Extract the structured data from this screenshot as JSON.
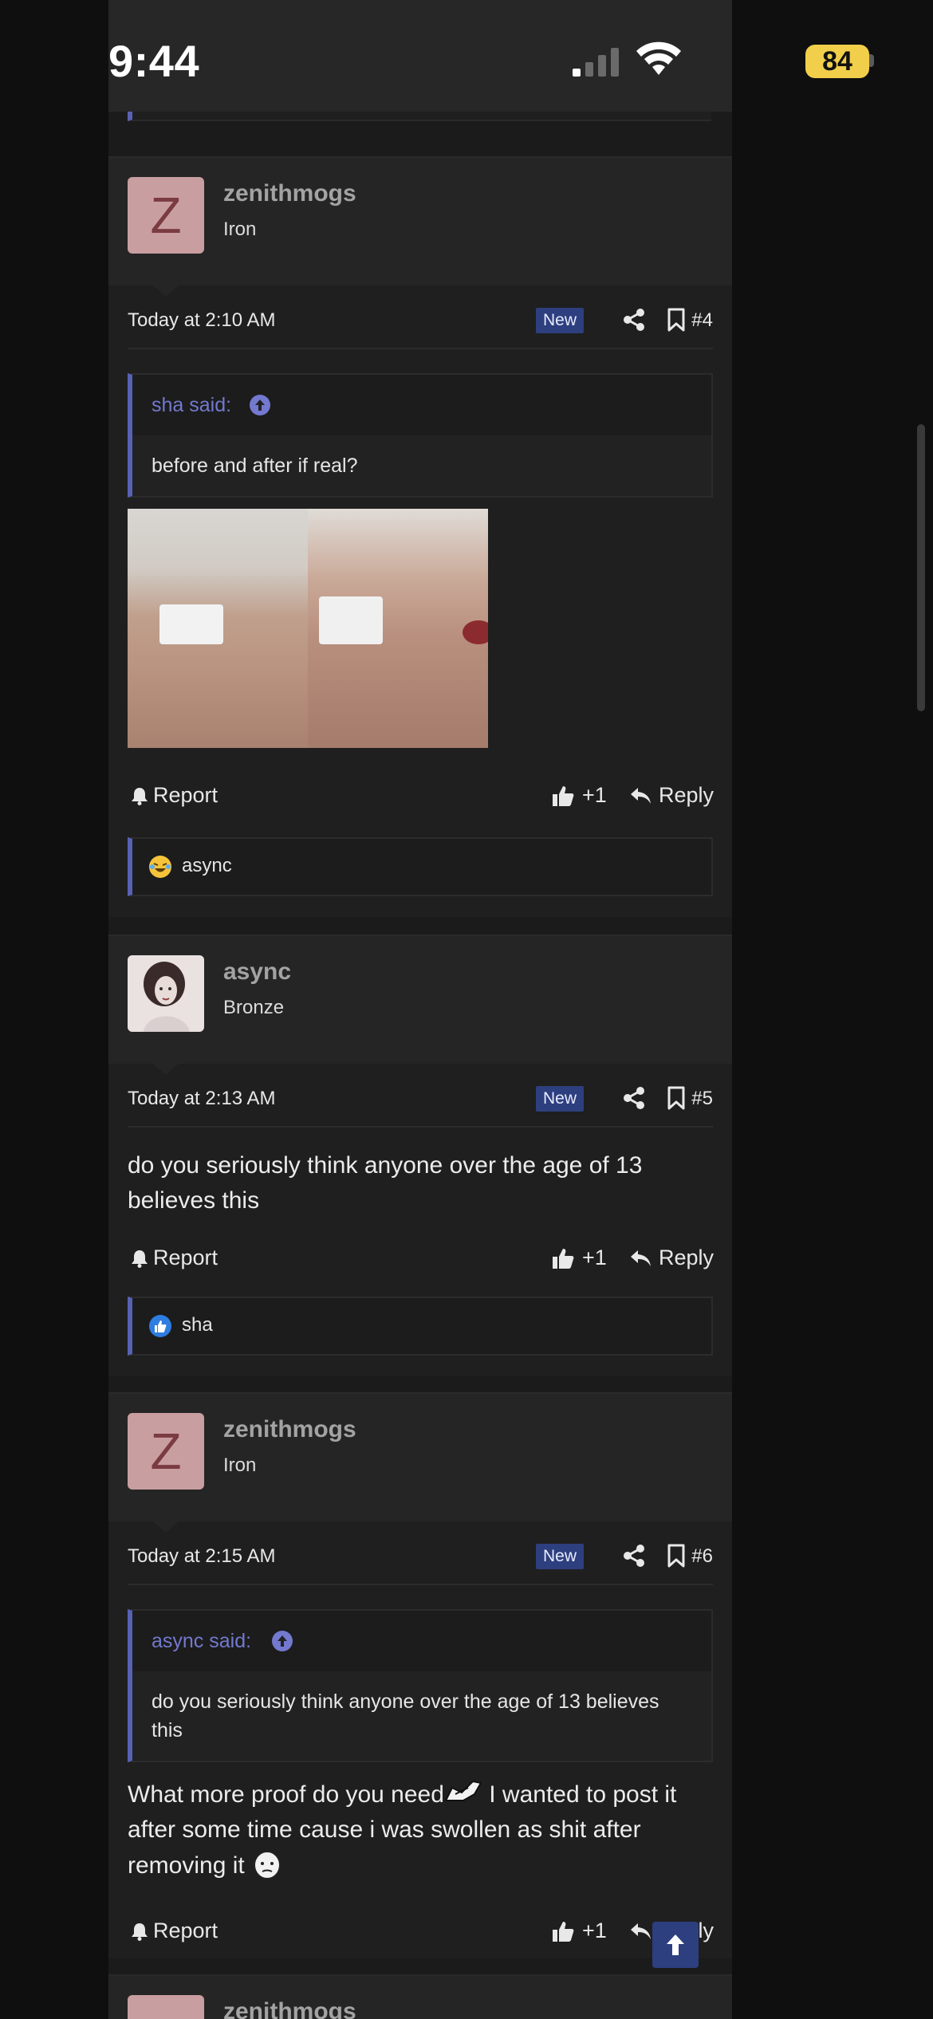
{
  "status": {
    "time": "9:44",
    "battery": "84"
  },
  "posts": [
    {
      "avatar_letter": "Z",
      "username": "zenithmogs",
      "rank": "Iron",
      "timestamp": "Today at 2:10 AM",
      "badge": "New",
      "number": "#4",
      "quote": {
        "author": "sha said:",
        "text": "before and after if real?"
      },
      "actions": {
        "report": "Report",
        "likes": "+1",
        "reply": "Reply"
      },
      "reaction_user": "async"
    },
    {
      "username": "async",
      "rank": "Bronze",
      "timestamp": "Today at 2:13 AM",
      "badge": "New",
      "number": "#5",
      "text": "do you seriously think anyone over the age of 13 believes this",
      "actions": {
        "report": "Report",
        "likes": "+1",
        "reply": "Reply"
      },
      "reaction_user": "sha"
    },
    {
      "avatar_letter": "Z",
      "username": "zenithmogs",
      "rank": "Iron",
      "timestamp": "Today at 2:15 AM",
      "badge": "New",
      "number": "#6",
      "quote": {
        "author": "async said:",
        "text": "do you seriously think anyone over the age of 13 believes this"
      },
      "text_part1": "What more proof do you need",
      "text_part2": " I wanted to post it after some time cause i was swollen as shit after removing it",
      "actions": {
        "report": "Report",
        "likes": "+1",
        "reply": "Reply"
      }
    },
    {
      "username": "zenithmogs"
    }
  ],
  "colors": {
    "accent": "#5961b3",
    "badge": "#2d3f7e",
    "avatar_bg": "#c99ea0",
    "battery": "#f2cf4a"
  }
}
